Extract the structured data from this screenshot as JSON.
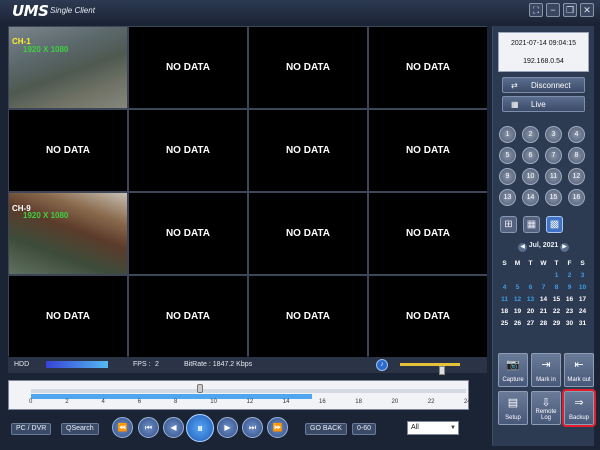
{
  "app": {
    "logo": "UMS",
    "subtitle": "Single Client",
    "window_buttons": [
      "⛶",
      "−",
      "❐",
      "✕"
    ]
  },
  "video_grid": {
    "cells": [
      {
        "type": "video",
        "channel": "CH-1",
        "resolution": "1920 X 1080",
        "selected": true
      },
      {
        "type": "empty",
        "label": "NO DATA"
      },
      {
        "type": "empty",
        "label": "NO DATA"
      },
      {
        "type": "empty",
        "label": "NO DATA"
      },
      {
        "type": "empty",
        "label": "NO DATA"
      },
      {
        "type": "empty",
        "label": "NO DATA"
      },
      {
        "type": "empty",
        "label": "NO DATA"
      },
      {
        "type": "empty",
        "label": "NO DATA"
      },
      {
        "type": "video",
        "channel": "CH-9",
        "resolution": "1920 X 1080",
        "selected": false
      },
      {
        "type": "empty",
        "label": "NO DATA"
      },
      {
        "type": "empty",
        "label": "NO DATA"
      },
      {
        "type": "empty",
        "label": "NO DATA"
      },
      {
        "type": "empty",
        "label": "NO DATA"
      },
      {
        "type": "empty",
        "label": "NO DATA"
      },
      {
        "type": "empty",
        "label": "NO DATA"
      },
      {
        "type": "empty",
        "label": "NO DATA"
      }
    ]
  },
  "status": {
    "hdd_label": "HDD",
    "fps_label": "FPS :",
    "fps_value": "2",
    "bitrate": "BitRate : 1847.2 Kbps",
    "volume_level": 0.7
  },
  "timeline": {
    "ticks": [
      "0",
      "2",
      "4",
      "6",
      "8",
      "10",
      "12",
      "14",
      "16",
      "18",
      "20",
      "22",
      "24"
    ],
    "recorded_until_hour": 15.5,
    "cursor_hour": 9.3
  },
  "playback": {
    "pc_dvr_label": "PC / DVR",
    "qsearch_label": "QSearch",
    "controls": [
      "⏪",
      "⏮",
      "◀",
      "⏸",
      "▶",
      "⏭",
      "⏩"
    ],
    "go_back_label": "GO BACK",
    "go_back_range": "0-60",
    "filter_value": "All"
  },
  "info": {
    "datetime": "2021-07-14 09:04:15",
    "ip": "192.168.0.54"
  },
  "buttons": {
    "disconnect": "Disconnect",
    "live": "Live"
  },
  "channels": [
    "1",
    "2",
    "3",
    "4",
    "5",
    "6",
    "7",
    "8",
    "9",
    "10",
    "11",
    "12",
    "13",
    "14",
    "15",
    "16"
  ],
  "calendar": {
    "title": "Jul, 2021",
    "days_of_week": [
      "S",
      "M",
      "T",
      "W",
      "T",
      "F",
      "S"
    ],
    "weeks": [
      [
        "",
        "",
        "",
        "",
        "1",
        "2",
        "3"
      ],
      [
        "4",
        "5",
        "6",
        "7",
        "8",
        "9",
        "10"
      ],
      [
        "11",
        "12",
        "13",
        "14",
        "15",
        "16",
        "17"
      ],
      [
        "18",
        "19",
        "20",
        "21",
        "22",
        "23",
        "24"
      ],
      [
        "25",
        "26",
        "27",
        "28",
        "29",
        "30",
        "31"
      ],
      [
        "",
        "",
        "",
        "",
        "",
        "",
        ""
      ]
    ],
    "recorded_days": [
      "1",
      "2",
      "3",
      "4",
      "5",
      "6",
      "7",
      "8",
      "9",
      "10",
      "11",
      "12",
      "13"
    ],
    "today": "14"
  },
  "tools": [
    {
      "label": "Capture",
      "icon": "camera-icon",
      "glyph": "📷"
    },
    {
      "label": "Mark in",
      "icon": "mark-in-icon",
      "glyph": "⇥"
    },
    {
      "label": "Mark out",
      "icon": "mark-out-icon",
      "glyph": "⇤"
    },
    {
      "label": "Setup",
      "icon": "setup-icon",
      "glyph": "▤"
    },
    {
      "label": "Remote Log",
      "icon": "remote-log-icon",
      "glyph": "⇩"
    },
    {
      "label": "Backup",
      "icon": "backup-icon",
      "glyph": "⇒",
      "highlighted": true
    }
  ],
  "colors": {
    "accent_blue": "#4ea6f0",
    "selected_cell": "#d2403f",
    "highlight_red": "#e21e2a",
    "calendar_blue": "#3c9ee8"
  }
}
